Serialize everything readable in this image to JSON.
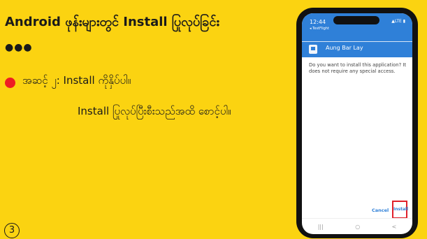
{
  "slide": {
    "title": "Android ဖုန်းများတွင် Install ပြုလုပ်ခြင်း",
    "dots": "●●●",
    "step_line1": "အဆင့် ၂: Install ကိုနှိပ်ပါ။",
    "step_line2": "Install ပြုလုပ်ပြီးစီးသည်အထိ စောင့်ပါ။",
    "page_number": "3",
    "bullet_color": "#ee1d23",
    "background_color": "#fbd311"
  },
  "phone": {
    "status_time": "12:44",
    "status_sub": "◂ TestFlight",
    "status_right": "▲LTE ▮",
    "app_name": "Aung Bar Lay",
    "prompt": "Do you want to install this application? It does not require any special access.",
    "cancel_label": "Cancel",
    "install_label": "Install",
    "nav_recent": "|||",
    "nav_home": "○",
    "nav_back": "<",
    "accent_color": "#2f80d8",
    "highlight_color": "#e0202a"
  }
}
